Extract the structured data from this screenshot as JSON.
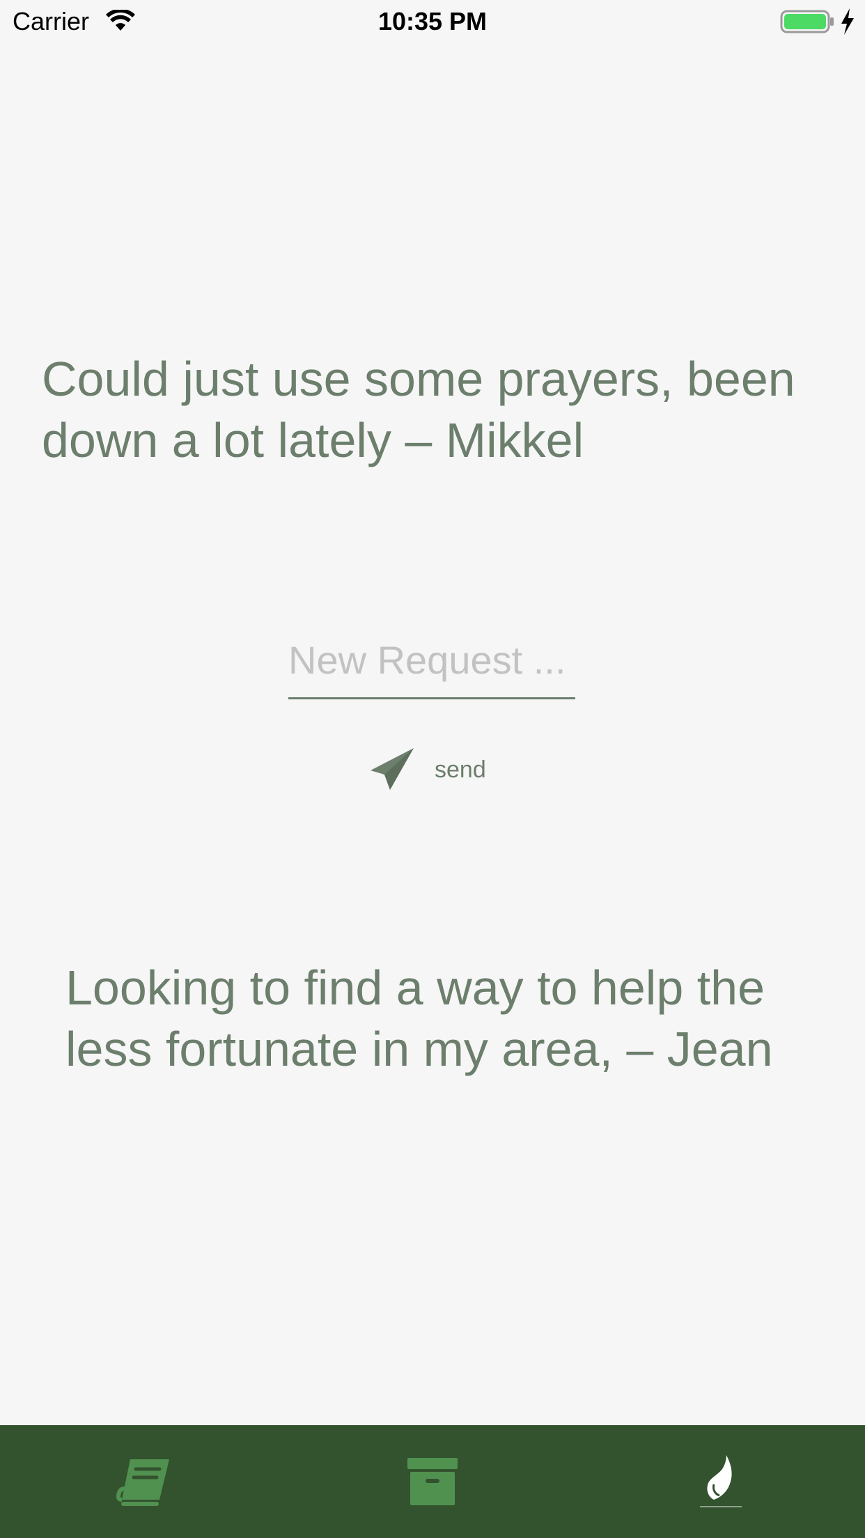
{
  "status_bar": {
    "carrier": "Carrier",
    "time": "10:35 PM",
    "battery_color": "#4cd964"
  },
  "messages": [
    {
      "text": "Could just use some prayers, been down a lot lately – Mikkel"
    },
    {
      "text": "Looking to find a way to help the less fortunate in my area, – Jean"
    }
  ],
  "request_input": {
    "placeholder": "New Request ...",
    "value": ""
  },
  "send_button": {
    "label": "send",
    "icon": "paper-plane-icon"
  },
  "tab_bar": {
    "background": "#33522e",
    "tabs": [
      {
        "icon": "book-icon",
        "active": false
      },
      {
        "icon": "archive-box-icon",
        "active": false
      },
      {
        "icon": "flame-icon",
        "active": true
      }
    ]
  },
  "colors": {
    "text_green": "#6c7e6c",
    "icon_green": "#509150",
    "background": "#f6f6f6"
  }
}
